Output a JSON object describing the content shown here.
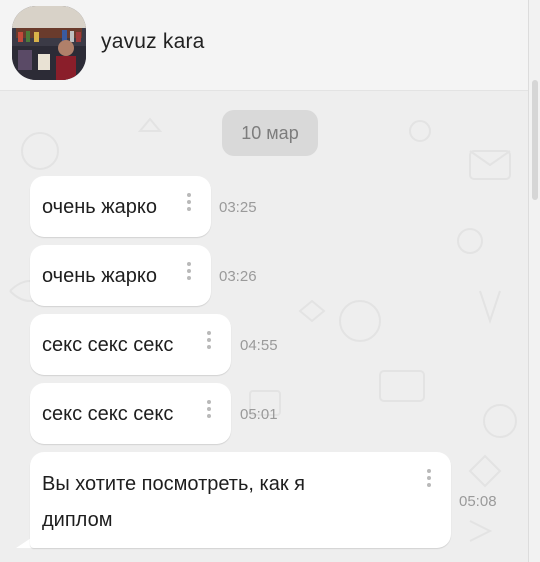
{
  "header": {
    "contact_name": "yavuz kara"
  },
  "chat": {
    "date_badge": "10 мар",
    "messages": [
      {
        "text": "очень жарко",
        "time": "03:25"
      },
      {
        "text": "очень жарко",
        "time": "03:26"
      },
      {
        "text": "секс секс секс",
        "time": "04:55"
      },
      {
        "text": "секс секс секс",
        "time": "05:01"
      },
      {
        "text_line1": "Вы хотите посмотреть, как я",
        "text_line2": "диплом",
        "time": "05:08"
      }
    ]
  },
  "icons": {
    "message_menu": "vertical-dots-icon"
  }
}
